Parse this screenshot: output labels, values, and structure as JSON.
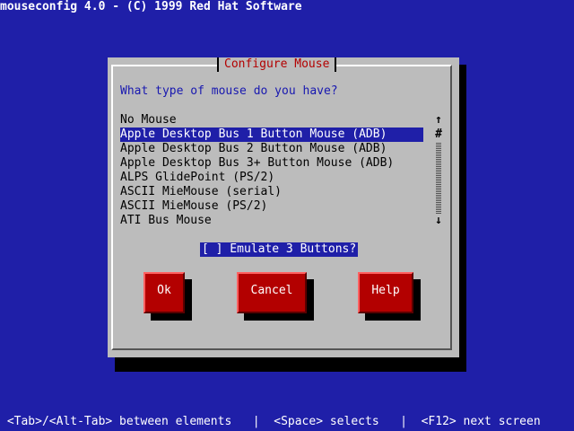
{
  "app_title": "mouseconfig 4.0 - (C) 1999 Red Hat Software",
  "dialog": {
    "title": "Configure Mouse",
    "question": "What type of mouse do you have?",
    "mouse_types": [
      "No Mouse",
      "Apple Desktop Bus 1 Button Mouse (ADB)",
      "Apple Desktop Bus 2 Button Mouse (ADB)",
      "Apple Desktop Bus 3+ Button Mouse (ADB)",
      "ALPS GlidePoint (PS/2)",
      "ASCII MieMouse (serial)",
      "ASCII MieMouse (PS/2)",
      "ATI Bus Mouse"
    ],
    "selected_mouse": "Apple Desktop Bus 1 Button Mouse (ADB)",
    "scrollbar": {
      "up_glyph": "↑",
      "thumb_glyph": "#",
      "down_glyph": "↓"
    },
    "emulate_checkbox": {
      "label": "[ ] Emulate 3 Buttons?",
      "checked": false
    },
    "buttons": {
      "ok": "Ok",
      "cancel": "Cancel",
      "help": "Help"
    }
  },
  "help_line": " <Tab>/<Alt-Tab> between elements   |  <Space> selects   |  <F12> next screen",
  "colors": {
    "background": "#1f1fa8",
    "dialog": "#bcbcbc",
    "title_text": "#b30000",
    "button": "#b30000",
    "question_text": "#1818b0"
  }
}
